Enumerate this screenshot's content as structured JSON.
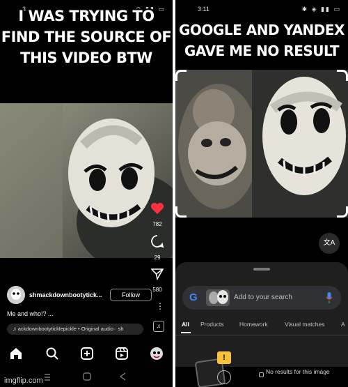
{
  "left_panel": {
    "caption_text": "I WAS TRYING TO FIND THE SOURCE OF THIS VIDEO BTW",
    "status_time": "3",
    "side_actions": [
      {
        "icon": "heart-icon",
        "count": "782"
      },
      {
        "icon": "comment-icon",
        "count": "29"
      },
      {
        "icon": "share-icon",
        "count": "580"
      }
    ],
    "post": {
      "username": "shmackdownbootytick...",
      "follow_label": "Follow",
      "caption": "Me and who!? ...",
      "audio": "ackdownbootyticklepickle • Original audio · sh"
    },
    "nav_icons": [
      "home-icon",
      "search-icon",
      "create-icon",
      "reels-icon",
      "profile-icon"
    ],
    "colors": {
      "like": "#ff3040"
    }
  },
  "right_panel": {
    "caption_text": "GOOGLE AND YANDEX GAVE ME NO RESULT",
    "status_time": "3:11",
    "search": {
      "placeholder": "Add to your search"
    },
    "tabs": [
      "All",
      "Products",
      "Homework",
      "Visual matches",
      "A"
    ],
    "active_tab": "All",
    "no_results_text": "No results for this image",
    "translate_icon": "translate-icon",
    "colors": {
      "warning": "#f9c23c",
      "mic": "#4285f4"
    }
  },
  "watermark": "imgflip.com"
}
